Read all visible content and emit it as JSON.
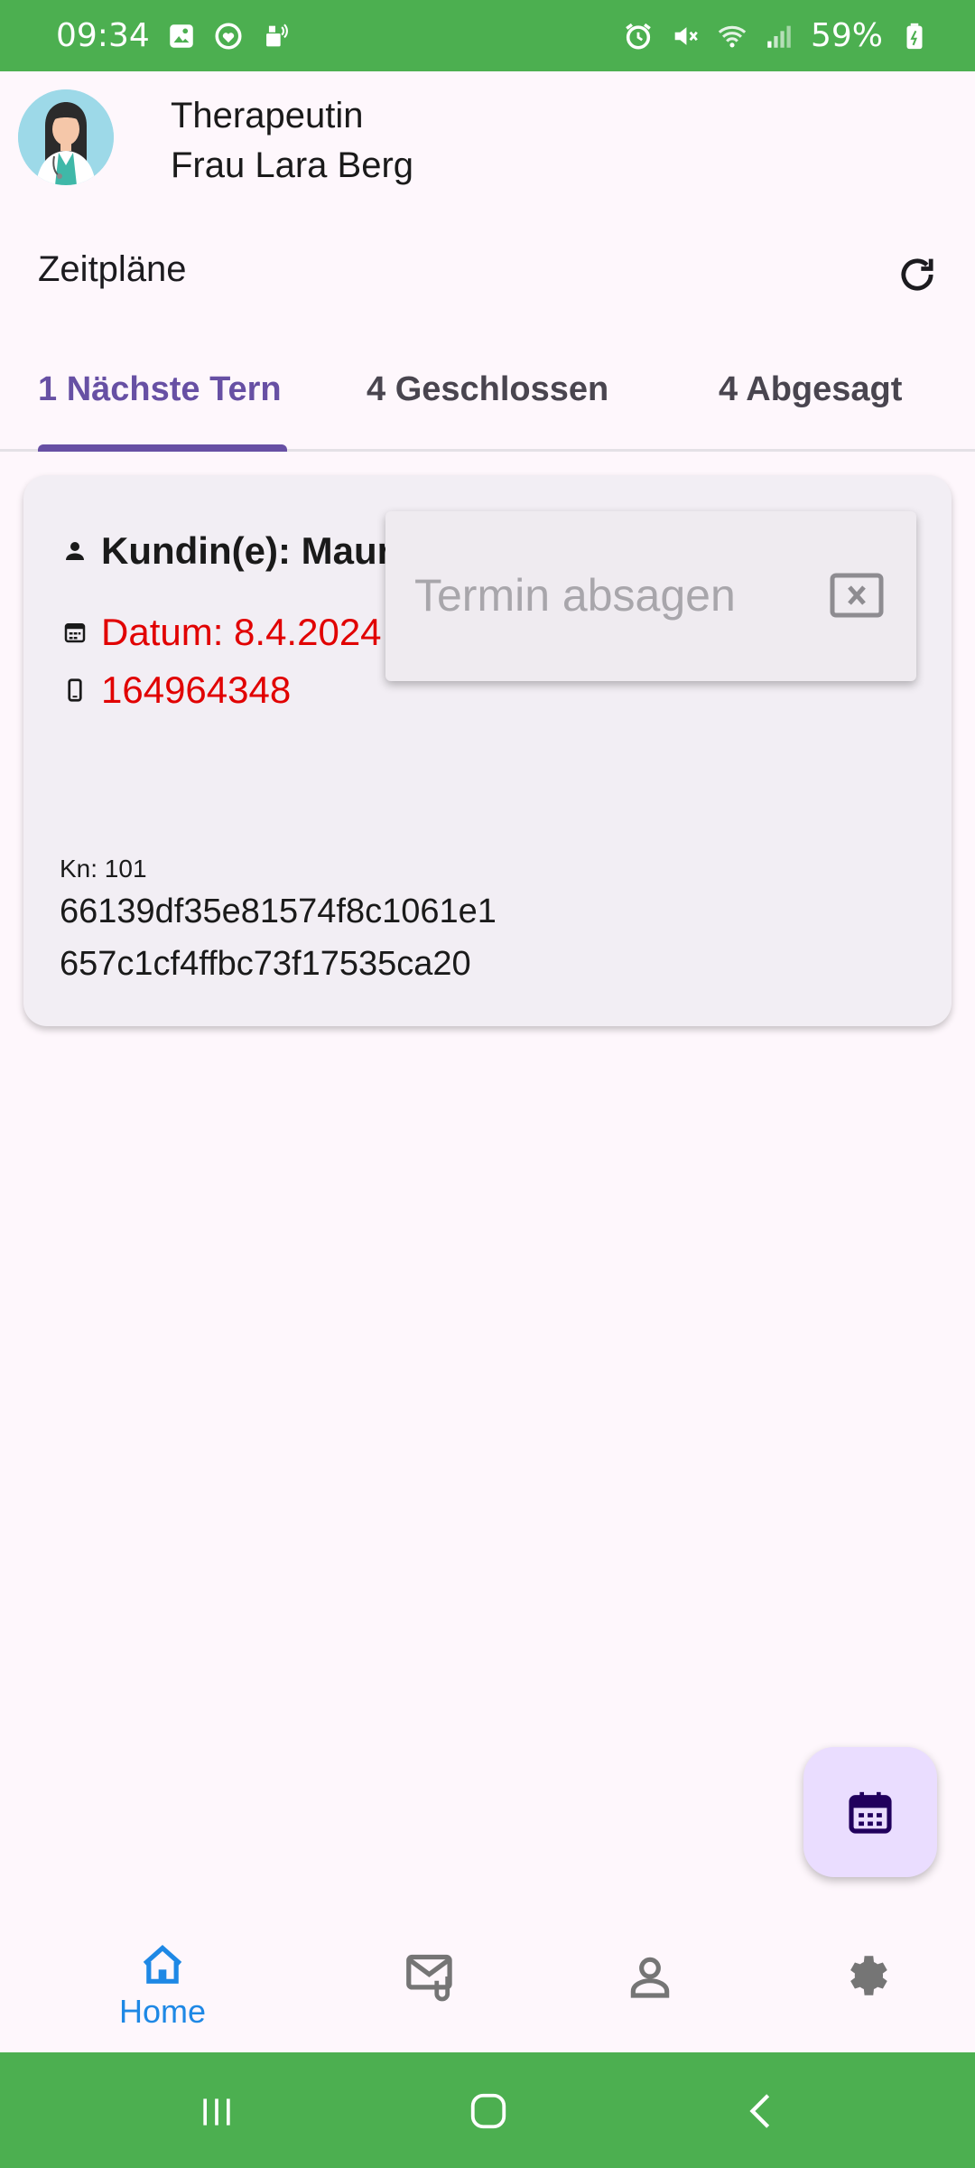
{
  "status_bar": {
    "time": "09:34",
    "battery": "59%",
    "left_icons": [
      "gallery-icon",
      "health-icon",
      "sim-icon"
    ],
    "right_icons": [
      "alarm-icon",
      "mute-icon",
      "wifi-icon",
      "signal-icon",
      "battery-icon"
    ]
  },
  "header": {
    "role": "Therapeutin",
    "name": "Frau Lara Berg",
    "avatar_icon": "doctor-avatar"
  },
  "page": {
    "title": "Zeitpläne",
    "refresh_icon": "refresh-icon"
  },
  "tabs": [
    {
      "label": "1 Nächste Tern",
      "active": true
    },
    {
      "label": "4 Geschlossen",
      "active": false
    },
    {
      "label": "4 Abgesagt",
      "active": false
    }
  ],
  "card": {
    "customer": "Kundin(e): Maur",
    "date": "Datum: 8.4.2024",
    "phone": "164964348",
    "kn": "Kn: 101",
    "id_line1": "66139df35e81574f8c1061e1",
    "id_line2": "657c1cf4ffbc73f17535ca20"
  },
  "popup": {
    "item_label": "Termin absagen",
    "item_icon": "close-box-icon"
  },
  "fab": {
    "icon": "calendar-icon"
  },
  "bottom_nav": [
    {
      "label": "Home",
      "icon": "home-icon",
      "active": true
    },
    {
      "label": "",
      "icon": "mail-attachment-icon",
      "active": false
    },
    {
      "label": "",
      "icon": "person-icon",
      "active": false
    },
    {
      "label": "",
      "icon": "settings-icon",
      "active": false
    }
  ],
  "colors": {
    "status_green": "#4CAF50",
    "primary_purple": "#6750A4",
    "alert_red": "#E10000",
    "nav_blue": "#1E88E5"
  }
}
